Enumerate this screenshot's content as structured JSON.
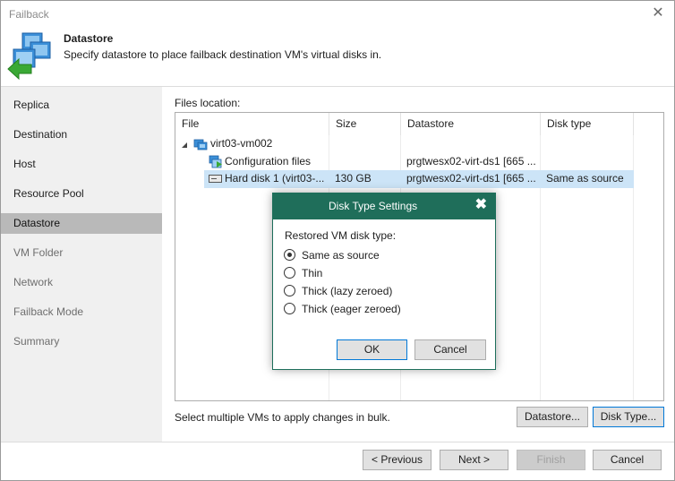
{
  "window": {
    "title": "Failback",
    "close_glyph": "✕"
  },
  "header": {
    "title": "Datastore",
    "subtitle": "Specify datastore to place failback destination VM's virtual disks in.",
    "icon": "failback-wizard-icon"
  },
  "sidebar": {
    "items": [
      {
        "label": "Replica",
        "state": "done"
      },
      {
        "label": "Destination",
        "state": "done"
      },
      {
        "label": "Host",
        "state": "done"
      },
      {
        "label": "Resource Pool",
        "state": "done"
      },
      {
        "label": "Datastore",
        "state": "active"
      },
      {
        "label": "VM Folder",
        "state": "pending"
      },
      {
        "label": "Network",
        "state": "pending"
      },
      {
        "label": "Failback Mode",
        "state": "pending"
      },
      {
        "label": "Summary",
        "state": "pending"
      }
    ]
  },
  "files": {
    "label": "Files location:",
    "columns": [
      "File",
      "Size",
      "Datastore",
      "Disk type"
    ],
    "rows": [
      {
        "name": "virt03-vm002",
        "size": "",
        "datastore": "",
        "disk_type": "",
        "icon": "vm-icon",
        "expand": "◢"
      },
      {
        "name": "Configuration files",
        "size": "",
        "datastore": "prgtwesx02-virt-ds1 [665 ...",
        "disk_type": "",
        "icon": "config-files-icon"
      },
      {
        "name": "Hard disk 1 (virt03-...",
        "size": "130 GB",
        "datastore": "prgtwesx02-virt-ds1 [665 ...",
        "disk_type": "Same as source",
        "icon": "hard-disk-icon"
      }
    ]
  },
  "bulk_hint": "Select multiple VMs to apply changes in bulk.",
  "buttons": {
    "datastore": "Datastore...",
    "disk_type": "Disk Type...",
    "previous": "< Previous",
    "next": "Next >",
    "finish": "Finish",
    "cancel": "Cancel"
  },
  "modal": {
    "title": "Disk Type Settings",
    "close_glyph": "✖",
    "label": "Restored VM disk type:",
    "options": [
      {
        "label": "Same as source",
        "checked": true
      },
      {
        "label": "Thin",
        "checked": false
      },
      {
        "label": "Thick (lazy zeroed)",
        "checked": false
      },
      {
        "label": "Thick (eager zeroed)",
        "checked": false
      }
    ],
    "ok": "OK",
    "cancel": "Cancel"
  },
  "colors": {
    "modal_header": "#1f6e5a",
    "selection": "#cce4f7",
    "sidebar_active": "#b9b9b9",
    "accent_blue": "#0078d7",
    "accent_green": "#3aa935"
  }
}
